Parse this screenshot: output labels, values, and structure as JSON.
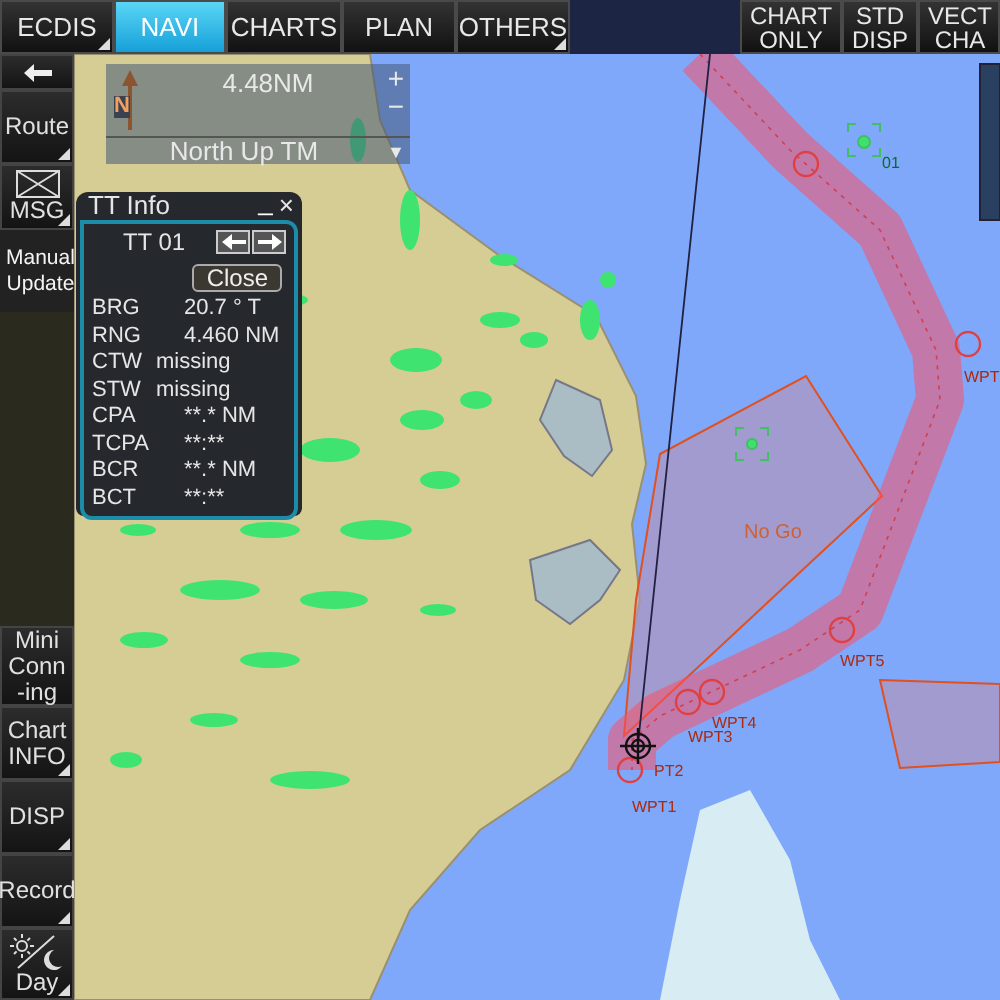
{
  "top_tabs": [
    {
      "label": "ECDIS",
      "selected": false,
      "has_menu": true
    },
    {
      "label": "NAVI",
      "selected": true,
      "has_menu": false
    },
    {
      "label": "CHARTS",
      "selected": false,
      "has_menu": false
    },
    {
      "label": "PLAN",
      "selected": false,
      "has_menu": false
    },
    {
      "label": "OTHERS",
      "selected": false,
      "has_menu": true
    }
  ],
  "top_buttons": [
    {
      "lines": [
        "CHART",
        "ONLY"
      ]
    },
    {
      "lines": [
        "STD",
        "DISP"
      ]
    },
    {
      "lines": [
        "VECT",
        "CHA"
      ]
    }
  ],
  "side_buttons": [
    {
      "kind": "back",
      "has_menu": false
    },
    {
      "kind": "text",
      "lines": [
        "Route"
      ],
      "has_menu": true
    },
    {
      "kind": "mail",
      "lines": [
        "MSG"
      ],
      "has_menu": true
    },
    {
      "kind": "plain",
      "lines": [
        "Manual",
        "Update"
      ],
      "has_menu": false
    },
    {
      "kind": "spacer",
      "has_menu": false
    },
    {
      "kind": "text",
      "lines": [
        "Mini",
        "Conn",
        "-ing"
      ],
      "has_menu": false
    },
    {
      "kind": "text",
      "lines": [
        "Chart",
        "INFO"
      ],
      "has_menu": true
    },
    {
      "kind": "text",
      "lines": [
        "DISP"
      ],
      "has_menu": true
    },
    {
      "kind": "text",
      "lines": [
        "Record"
      ],
      "has_menu": true
    },
    {
      "kind": "daynight",
      "lines": [
        "Day"
      ],
      "has_menu": true
    }
  ],
  "scale_box": {
    "range": "4.48NM",
    "zoom_in": "+",
    "zoom_out": "−",
    "north": "N",
    "mode": "North  Up TM",
    "dropdown": "▼"
  },
  "tt_info": {
    "title": "TT Info",
    "minimize": "_",
    "close_x": "×",
    "tab": "TT 01",
    "close_button": "Close",
    "rows": [
      {
        "label": "BRG",
        "value": "20.7 ° T"
      },
      {
        "label": "RNG",
        "value": "4.460 NM"
      },
      {
        "label": "CTW",
        "value": "missing"
      },
      {
        "label": "STW",
        "value": "missing"
      },
      {
        "label": "CPA",
        "value": "**.* NM"
      },
      {
        "label": "TCPA",
        "value": "**:**"
      },
      {
        "label": "BCR",
        "value": "**.* NM"
      },
      {
        "label": "BCT",
        "value": "**:**"
      }
    ]
  },
  "chart_labels": [
    {
      "kind": "target",
      "text": "01"
    },
    {
      "kind": "waypoint",
      "text": "WPT"
    },
    {
      "kind": "zone",
      "text": "No Go"
    },
    {
      "kind": "waypoint",
      "text": "WPT5"
    },
    {
      "kind": "waypoint",
      "text": "WPT4"
    },
    {
      "kind": "waypoint",
      "text": "WPT3"
    },
    {
      "kind": "waypoint",
      "text": "PT2"
    },
    {
      "kind": "waypoint",
      "text": "WPT1"
    }
  ]
}
